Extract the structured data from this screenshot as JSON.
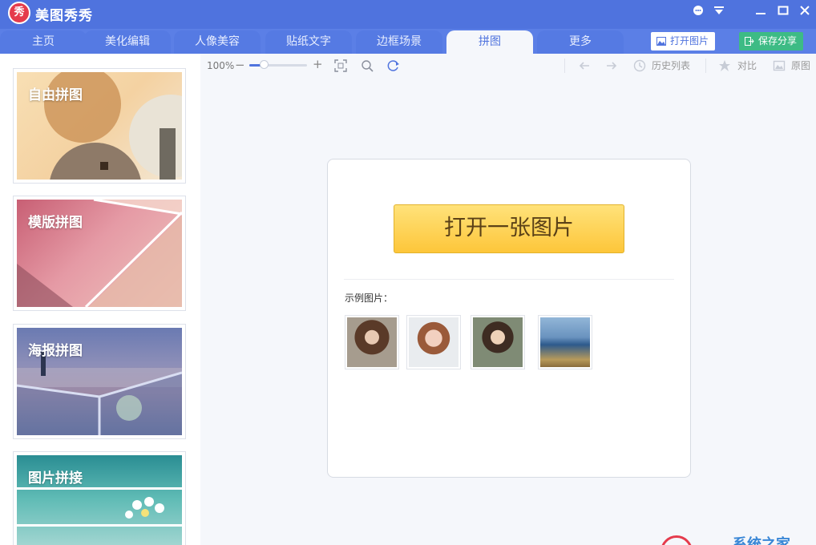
{
  "app": {
    "logo_text": "秀",
    "title": "美图秀秀"
  },
  "tabs": [
    {
      "label": "主页"
    },
    {
      "label": "美化编辑"
    },
    {
      "label": "人像美容"
    },
    {
      "label": "贴纸文字"
    },
    {
      "label": "边框场景"
    },
    {
      "label": "拼图",
      "active": true
    },
    {
      "label": "更多"
    }
  ],
  "header_buttons": {
    "open_image": "打开图片",
    "save_share": "保存分享"
  },
  "left_cards": [
    {
      "label": "自由拼图"
    },
    {
      "label": "模版拼图"
    },
    {
      "label": "海报拼图"
    },
    {
      "label": "图片拼接"
    }
  ],
  "toolbar": {
    "zoom_level": "100%",
    "zoom_fraction": 0.25,
    "minus": "−",
    "plus": "+",
    "history": "历史列表",
    "compare": "对比",
    "original": "原图"
  },
  "main": {
    "open_button": "打开一张图片",
    "sample_label": "示例图片："
  },
  "watermark": {
    "text": "系统之家"
  },
  "colors": {
    "brand_blue": "#4f73de",
    "save_green": "#3dbb85",
    "open_yellow": "#fdc63a",
    "logo_red": "#e53b4c"
  }
}
